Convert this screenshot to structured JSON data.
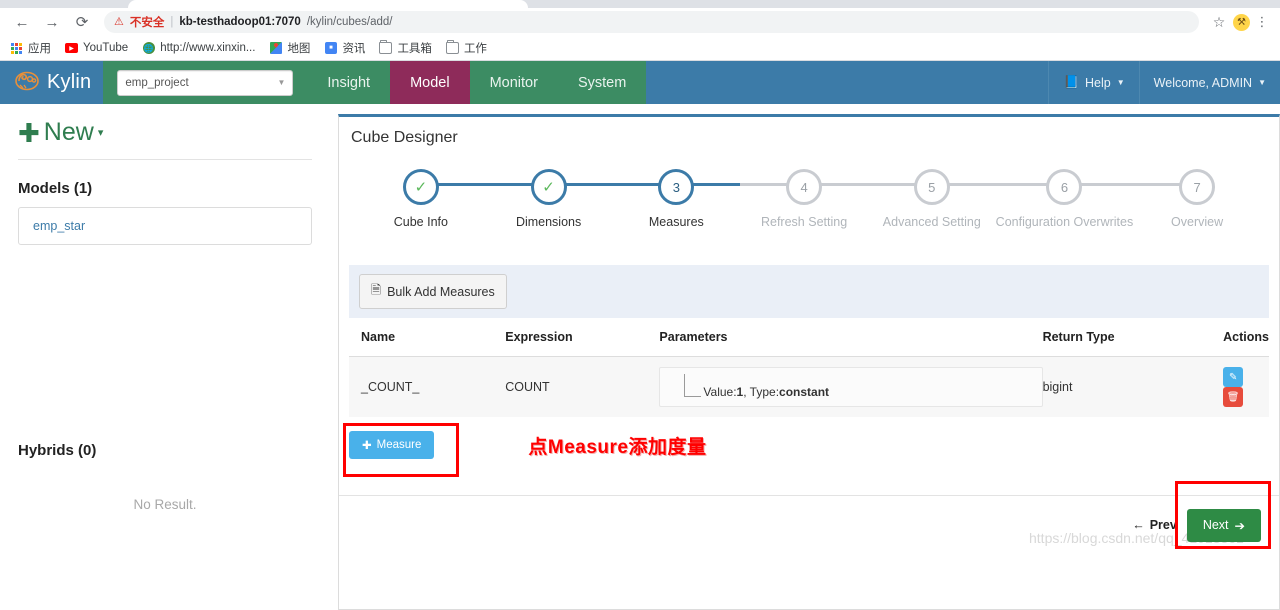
{
  "browser": {
    "nav": {
      "back": "←",
      "forward": "→",
      "reload": "⟳"
    },
    "security": {
      "icon": "warning-triangle-icon",
      "label": "不安全"
    },
    "url_host": "kb-testhadoop01:7070",
    "url_path": "/kylin/cubes/add/",
    "star": "☆",
    "menu": "⋮",
    "bookmarks": [
      {
        "icon": "apps-grid-icon",
        "label": "应用"
      },
      {
        "icon": "youtube-icon",
        "label": "YouTube"
      },
      {
        "icon": "globe-icon",
        "label": "http://www.xinxin..."
      },
      {
        "icon": "maps-icon",
        "label": "地图"
      },
      {
        "icon": "news-icon",
        "label": "资讯"
      },
      {
        "icon": "folder-icon",
        "label": "工具箱"
      },
      {
        "icon": "folder-icon",
        "label": "工作"
      }
    ]
  },
  "navbar": {
    "brand": "Kylin",
    "project": {
      "value": "emp_project",
      "caret": "▼"
    },
    "items": [
      {
        "label": "Insight",
        "active": false
      },
      {
        "label": "Model",
        "active": true
      },
      {
        "label": "Monitor",
        "active": false
      },
      {
        "label": "System",
        "active": false
      }
    ],
    "help": "Help",
    "user": "Welcome, ADMIN",
    "caret": "▾",
    "colors": {
      "bg": "#3c7ba8",
      "green": "#3c8c63",
      "active": "#8e2b5a"
    }
  },
  "sidebar": {
    "new_button": {
      "plus": "✚",
      "label": "New",
      "caret": "▾"
    },
    "models_title": "Models (1)",
    "models": [
      {
        "label": "emp_star"
      }
    ],
    "hybrids_title": "Hybrids (0)",
    "no_result": "No Result."
  },
  "panel": {
    "title": "Cube Designer",
    "steps": [
      {
        "num": "1",
        "label": "Cube Info",
        "state": "done"
      },
      {
        "num": "2",
        "label": "Dimensions",
        "state": "done"
      },
      {
        "num": "3",
        "label": "Measures",
        "state": "current"
      },
      {
        "num": "4",
        "label": "Refresh Setting",
        "state": "todo"
      },
      {
        "num": "5",
        "label": "Advanced Setting",
        "state": "todo"
      },
      {
        "num": "6",
        "label": "Configuration Overwrites",
        "state": "todo"
      },
      {
        "num": "7",
        "label": "Overview",
        "state": "todo"
      }
    ],
    "bulk_add": {
      "icon": "list-icon",
      "label": "Bulk Add Measures"
    },
    "table": {
      "columns": [
        "Name",
        "Expression",
        "Parameters",
        "Return Type",
        "Actions"
      ],
      "rows": [
        {
          "name": "_COUNT_",
          "expression": "COUNT",
          "param_prefix": "Value:",
          "param_value": "1",
          "param_mid": ", Type:",
          "param_type": "constant",
          "return_type": "bigint",
          "actions": {
            "edit": "✏",
            "delete": "🗑"
          }
        }
      ]
    },
    "measure_button": {
      "plus": "✚",
      "label": "Measure"
    },
    "annotation": "点Measure添加度量",
    "footer": {
      "prev": "Prev",
      "prev_arrow": "←",
      "next": "Next",
      "next_arrow": "➔"
    }
  },
  "watermark": "https://blog.csdn.net/qq_41018861"
}
